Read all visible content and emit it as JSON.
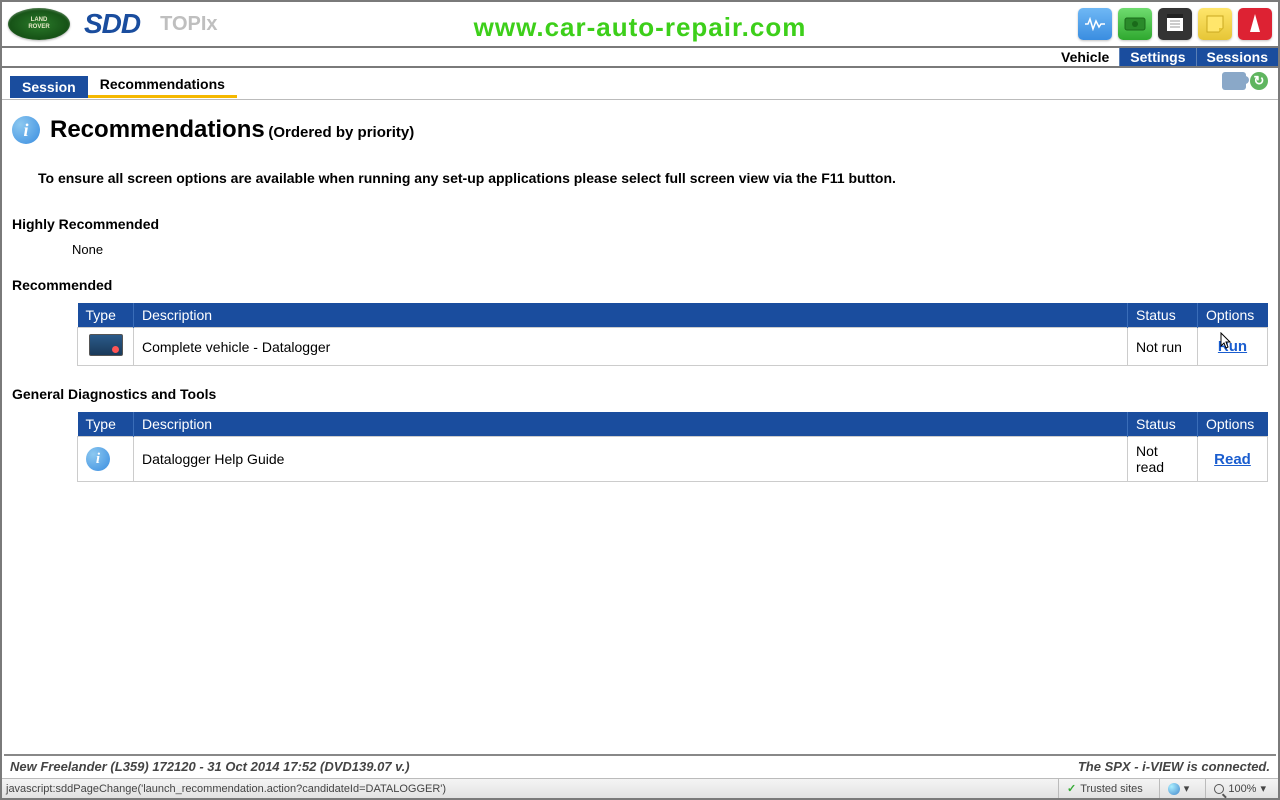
{
  "brand": {
    "landrover_text": "LAND-\nROVER",
    "sdd": "SDD",
    "topix": "TOPIx"
  },
  "watermark": "www.car-auto-repair.com",
  "topnav": {
    "vehicle": "Vehicle",
    "settings": "Settings",
    "sessions": "Sessions"
  },
  "subtabs": {
    "session": "Session",
    "recommendations": "Recommendations"
  },
  "page": {
    "title": "Recommendations",
    "subtitle": "(Ordered by priority)",
    "instruction": "To ensure all screen options are available when running any set-up applications please select full screen view via the F11 button."
  },
  "sections": {
    "highly": {
      "label": "Highly Recommended",
      "none": "None"
    },
    "recommended": {
      "label": "Recommended"
    },
    "general": {
      "label": "General Diagnostics and Tools"
    }
  },
  "table": {
    "headers": {
      "type": "Type",
      "description": "Description",
      "status": "Status",
      "options": "Options"
    },
    "recommended_rows": [
      {
        "description": "Complete vehicle - Datalogger",
        "status": "Not run",
        "action": "Run"
      }
    ],
    "general_rows": [
      {
        "description": "Datalogger Help Guide",
        "status": "Not read",
        "action": "Read"
      }
    ]
  },
  "footer": {
    "left": "New Freelander (L359) 172120 - 31 Oct 2014 17:52 (DVD139.07 v.)",
    "right": "The SPX - i-VIEW is connected."
  },
  "browser": {
    "js": "javascript:sddPageChange('launch_recommendation.action?candidateId=DATALOGGER')",
    "trusted": "Trusted sites",
    "zoom": "100%"
  }
}
